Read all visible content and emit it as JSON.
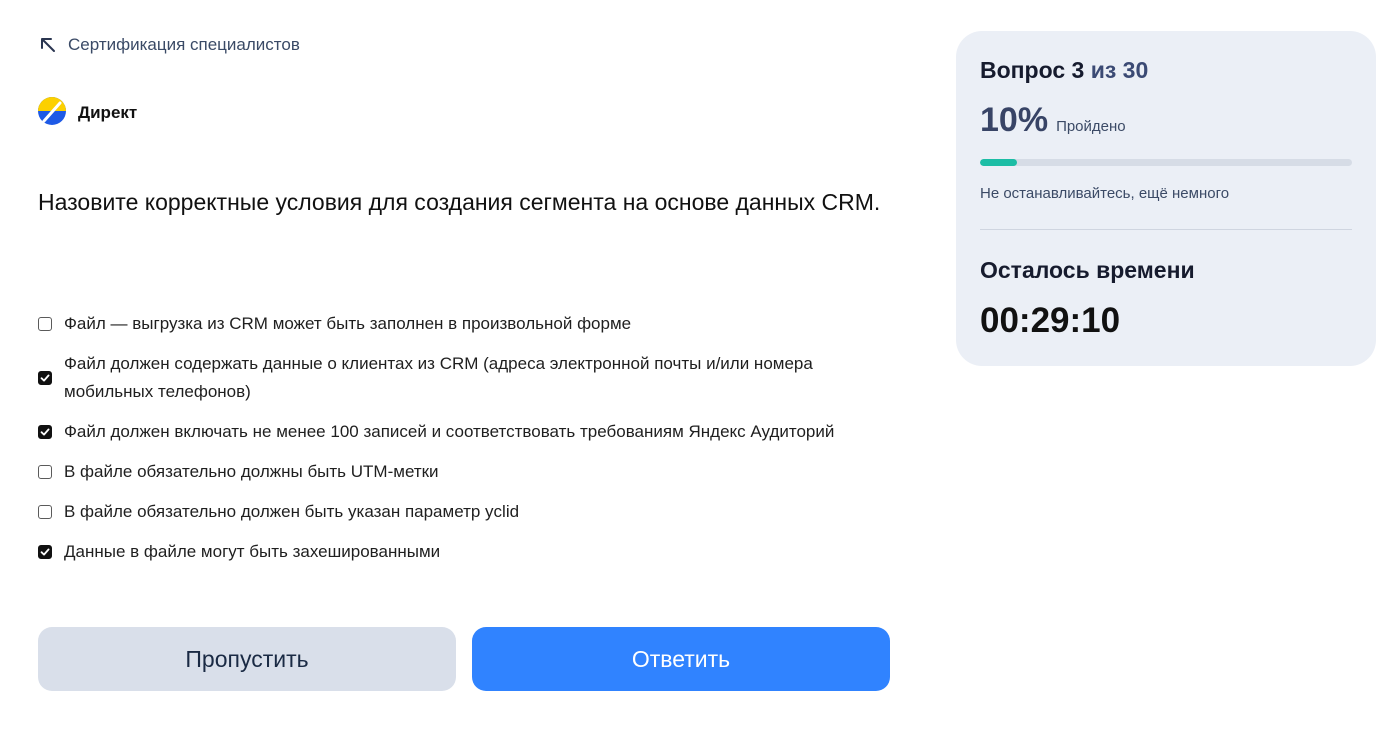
{
  "nav": {
    "back_label": "Сертификация специалистов"
  },
  "product": {
    "name": "Директ",
    "logo_colors": [
      "#fcd000",
      "#1e5ae6"
    ]
  },
  "question": {
    "text": "Назовите корректные условия для создания сегмента на основе данных CRM."
  },
  "options": [
    {
      "text": "Файл — выгрузка из CRM может быть заполнен в произвольной форме",
      "checked": false
    },
    {
      "text": "Файл должен содержать данные о клиентах из CRM (адреса электронной почты и/или номера мобильных телефонов)",
      "checked": true
    },
    {
      "text": "Файл должен включать не менее 100 записей и соответствовать требованиям Яндекс Аудиторий",
      "checked": true
    },
    {
      "text": "В файле обязательно должны быть UTM-метки",
      "checked": false
    },
    {
      "text": "В файле обязательно должен быть указан параметр yclid",
      "checked": false
    },
    {
      "text": "Данные в файле могут быть захешированными",
      "checked": true
    }
  ],
  "buttons": {
    "skip_label": "Пропустить",
    "answer_label": "Ответить"
  },
  "progress": {
    "question_word": "Вопрос",
    "current": "3",
    "of_label": "из 30",
    "percent_text": "10%",
    "percent_value": 0.1,
    "percent_label": "Пройдено",
    "encourage": "Не останавливайтесь, ещё немного"
  },
  "timer": {
    "title": "Осталось времени",
    "value": "00:29:10"
  },
  "colors": {
    "accent": "#3083ff",
    "progress": "#1cbda5",
    "panel_bg": "#ebeff6"
  }
}
